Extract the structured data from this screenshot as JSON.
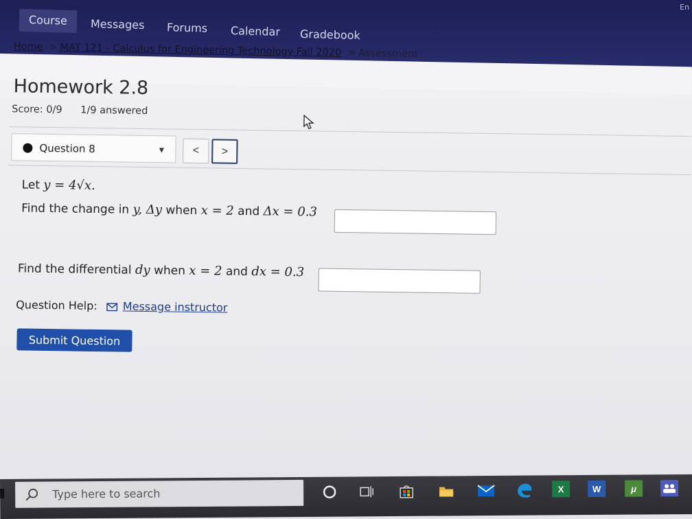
{
  "nav": {
    "tabs": [
      {
        "label": "Course"
      },
      {
        "label": "Messages"
      },
      {
        "label": "Forums"
      },
      {
        "label": "Calendar"
      },
      {
        "label": "Gradebook"
      }
    ],
    "corner_label": "En"
  },
  "breadcrumb": {
    "home": "Home",
    "sep1": ">",
    "course": "MAT 121 - Calculus for Engineering Technology Fall 2020",
    "sep2": ">",
    "current": "Assessment"
  },
  "assignment": {
    "title": "Homework 2.8",
    "score": "Score: 0/9",
    "answered": "1/9 answered"
  },
  "question_nav": {
    "selected": "Question 8",
    "prev_label": "<",
    "next_label": ">"
  },
  "question": {
    "intro_prefix": "Let",
    "intro_math": "y = 4√x.",
    "part1": {
      "text_a": "Find the change in",
      "var_y": "y, Δy",
      "text_b": "when",
      "cond1": "x = 2",
      "and": "and",
      "cond2": "Δx = 0.3"
    },
    "part2": {
      "text_a": "Find the differential",
      "var": "dy",
      "text_b": "when",
      "cond1": "x = 2",
      "and": "and",
      "cond2": "dx = 0.3"
    }
  },
  "help": {
    "label": "Question Help:",
    "link": "Message instructor"
  },
  "submit_label": "Submit Question",
  "taskbar": {
    "search_placeholder": "Type here to search",
    "icons": [
      "cortana-icon",
      "task-view-icon",
      "store-icon",
      "file-explorer-icon",
      "mail-icon",
      "edge-icon",
      "excel-icon",
      "word-icon",
      "mathtype-icon",
      "teams-icon"
    ]
  },
  "colors": {
    "nav_bg": "#232662",
    "submit_bg": "#1f4fa8",
    "link": "#1e3c8a"
  }
}
